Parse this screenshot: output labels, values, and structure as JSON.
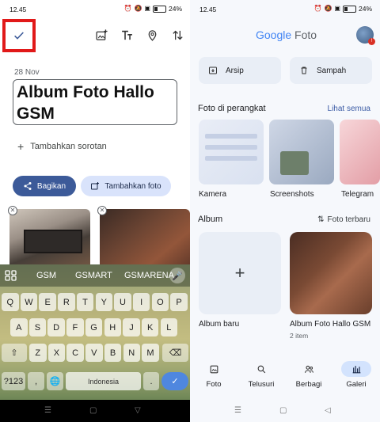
{
  "left": {
    "status": {
      "time": "12.45",
      "battery": "24%",
      "battery_level": 0.24
    },
    "date": "28 Nov",
    "title_input": "Album Foto Hallo GSM",
    "add_highlight": "Tambahkan sorotan",
    "share_button": "Bagikan",
    "add_photo_button": "Tambahkan foto",
    "keyboard": {
      "suggestions": [
        "GSM",
        "GSMART",
        "GSMARENA"
      ],
      "row1": [
        "Q",
        "W",
        "E",
        "R",
        "T",
        "Y",
        "U",
        "I",
        "O",
        "P"
      ],
      "row1_hints": [
        "1",
        "2",
        "3",
        "4",
        "5",
        "6",
        "7",
        "8",
        "9",
        "0"
      ],
      "row2": [
        "A",
        "S",
        "D",
        "F",
        "G",
        "H",
        "J",
        "K",
        "L"
      ],
      "row3": [
        "Z",
        "X",
        "C",
        "V",
        "B",
        "N",
        "M"
      ],
      "symbols_key": "?123",
      "comma_key": ",",
      "space_label": "Indonesia",
      "period_key": "."
    }
  },
  "right": {
    "status": {
      "time": "12.45",
      "battery": "24%",
      "battery_level": 0.24
    },
    "app_title_google": "Google",
    "app_title_foto": "Foto",
    "avatar_badge": "!",
    "archive": "Arsip",
    "trash": "Sampah",
    "device_section": "Foto di perangkat",
    "see_all": "Lihat semua",
    "device_folders": [
      "Kamera",
      "Screenshots",
      "Telegram"
    ],
    "album_section": "Album",
    "sort_label": "Foto terbaru",
    "new_album": "Album baru",
    "album_name": "Album Foto Hallo GSM",
    "album_count": "2 item",
    "nav": [
      "Foto",
      "Telusuri",
      "Berbagi",
      "Galeri"
    ]
  },
  "colors": {
    "highlight_red": "#e11919",
    "share_blue": "#3c5a99",
    "accent_light": "#d9e3fb",
    "keyboard_enter": "#4f87df"
  }
}
